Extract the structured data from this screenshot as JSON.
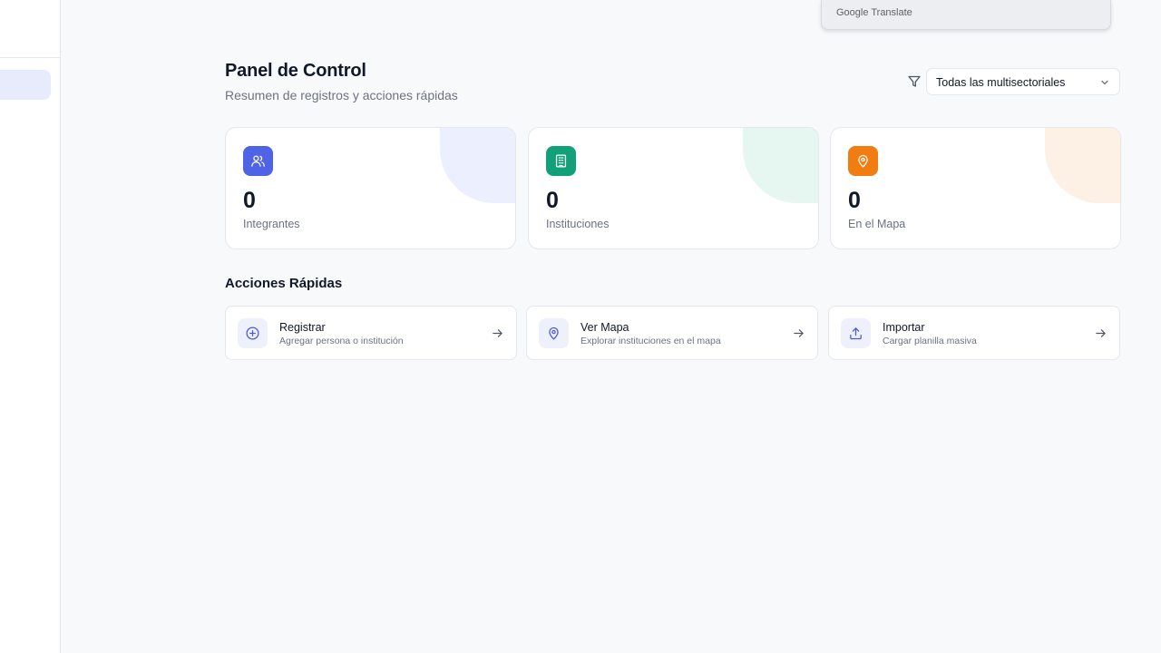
{
  "google_translate": {
    "brand": "Google",
    "product": "Translate"
  },
  "header": {
    "title": "Panel de Control",
    "subtitle": "Resumen de registros y acciones rápidas",
    "filter": {
      "selected": "Todas las multisectoriales",
      "icon": "filter-icon"
    }
  },
  "stats": [
    {
      "value": "0",
      "label": "Integrantes",
      "icon": "users-icon",
      "color": "#4f63e6",
      "tint": "#eceffd"
    },
    {
      "value": "0",
      "label": "Instituciones",
      "icon": "building-icon",
      "color": "#12a07a",
      "tint": "#e6f6f0"
    },
    {
      "value": "0",
      "label": "En el Mapa",
      "icon": "map-pin-icon",
      "color": "#f07c12",
      "tint": "#fdf0e4"
    }
  ],
  "quick_actions": {
    "title": "Acciones Rápidas",
    "items": [
      {
        "title": "Registrar",
        "description": "Agregar persona o institución",
        "icon": "plus-circle-icon"
      },
      {
        "title": "Ver Mapa",
        "description": "Explorar instituciones en el mapa",
        "icon": "map-pin-icon"
      },
      {
        "title": "Importar",
        "description": "Cargar planilla masiva",
        "icon": "upload-icon"
      }
    ]
  }
}
